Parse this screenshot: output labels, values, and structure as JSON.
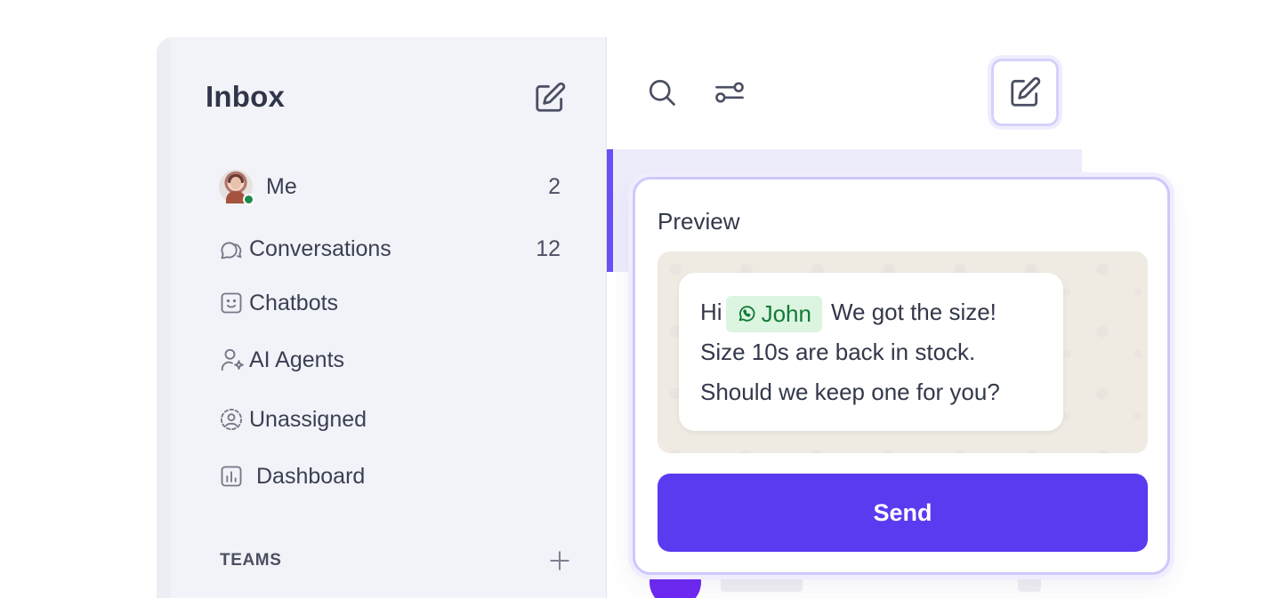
{
  "sidebar": {
    "title": "Inbox",
    "compose_icon": "edit-square-icon",
    "items": [
      {
        "label": "Me",
        "count": "2",
        "icon": "user-avatar"
      },
      {
        "label": "Conversations",
        "count": "12",
        "icon": "chat-bubbles-icon"
      },
      {
        "label": "Chatbots",
        "count": "",
        "icon": "bot-face-icon"
      },
      {
        "label": "AI Agents",
        "count": "",
        "icon": "person-sparkle-icon"
      },
      {
        "label": "Unassigned",
        "count": "",
        "icon": "user-circle-dashed-icon"
      },
      {
        "label": "Dashboard",
        "count": "",
        "icon": "bar-chart-icon"
      }
    ],
    "teams_label": "TEAMS",
    "teams_add_icon": "plus-icon"
  },
  "toolbar": {
    "search_icon": "search-icon",
    "filter_icon": "filter-sliders-icon",
    "compose_icon": "edit-square-icon"
  },
  "preview": {
    "title": "Preview",
    "message": {
      "greeting": "Hi",
      "contact_chip": "John",
      "chip_icon": "whatsapp-icon",
      "line1_rest": "We got the size!",
      "line2": "Size 10s are back in stock.",
      "line3": "Should we keep one for you?"
    },
    "send_label": "Send"
  },
  "colors": {
    "accent": "#5b3af0",
    "selected_row": "#ececfb",
    "online": "#1d8a4d",
    "chip_bg": "#dcf5e1",
    "chip_text": "#127a36",
    "chat_bg": "#efeae2"
  }
}
